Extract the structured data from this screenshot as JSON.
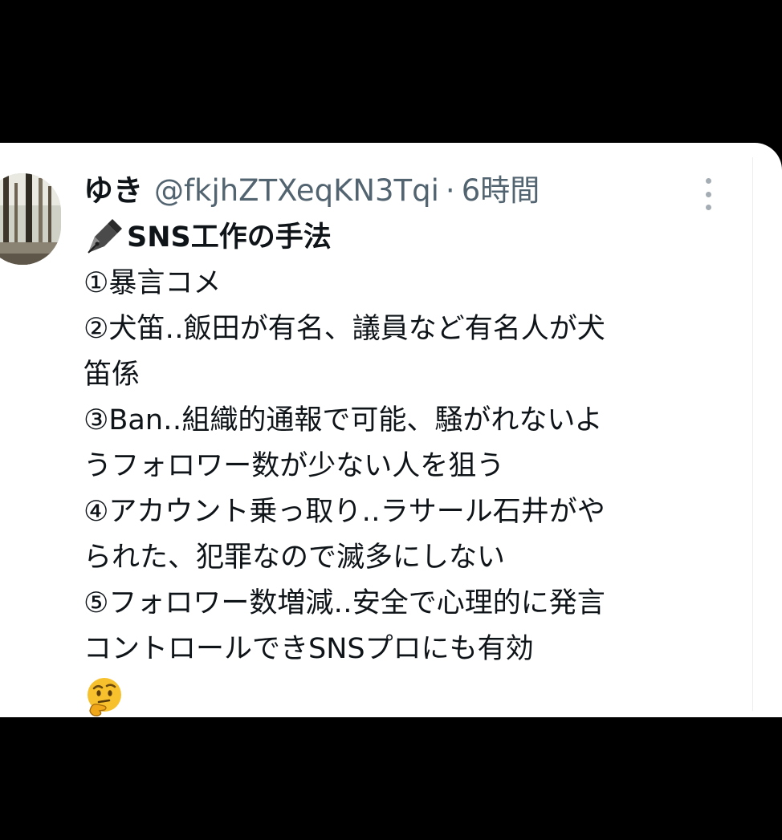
{
  "tweet": {
    "display_name": "ゆき",
    "handle": "@fkjhZTXeqKN3Tqi",
    "separator": "·",
    "time": "6時間",
    "more_icon": "more-vertical-icon",
    "title_icon": "fountain-pen-icon",
    "title": "SNS工作の手法",
    "lines": [
      "①暴言コメ",
      "②犬笛‥飯田が有名、議員など有名人が犬",
      "笛係",
      "③Ban‥組織的通報で可能、騒がれないよ",
      "うフォロワー数が少ない人を狙う",
      "④アカウント乗っ取り‥ラサール石井がや",
      "られた、犯罪なので滅多にしない",
      "⑤フォロワー数増減‥安全で心理的に発言",
      "コントロールできSNSプロにも有効"
    ],
    "end_emoji": "thinking-face-icon"
  },
  "colors": {
    "background": "#000000",
    "card": "#ffffff",
    "text": "#0f1419",
    "secondary_text": "#536471"
  }
}
